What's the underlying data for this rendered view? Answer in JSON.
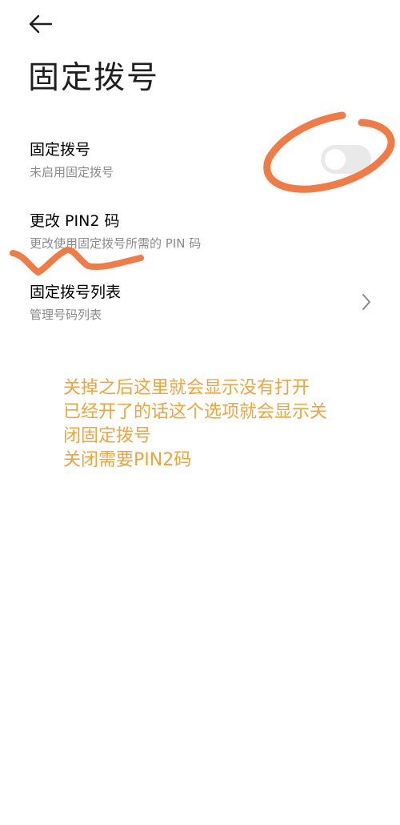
{
  "header": {
    "back_icon": "back-arrow-icon",
    "title": "固定拨号"
  },
  "settings": {
    "fixed_dialing": {
      "title": "固定拨号",
      "subtitle": "未启用固定拨号",
      "toggle_on": false
    },
    "change_pin2": {
      "title": "更改 PIN2 码",
      "subtitle": "更改使用固定拨号所需的 PIN 码"
    },
    "fdn_list": {
      "title": "固定拨号列表",
      "subtitle": "管理号码列表",
      "icon": "chevron-right-icon"
    }
  },
  "annotations": {
    "note_lines": [
      "关掉之后这里就会显示没有打开",
      "已经开了的话这个选项就会显示关",
      "闭固定拨号",
      "关闭需要PIN2码"
    ],
    "ink_color": "#f07b45",
    "note_color": "#f2a33a"
  }
}
